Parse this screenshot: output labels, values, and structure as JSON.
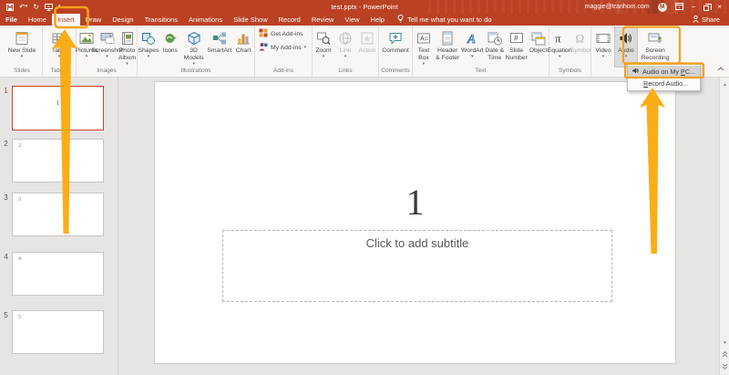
{
  "titlebar": {
    "title": "test.pptx - PowerPoint",
    "account_email": "maggie@tranhom.com",
    "avatar_initial": "M",
    "share_label": "Share"
  },
  "tabs": [
    "File",
    "Home",
    "Insert",
    "Draw",
    "Design",
    "Transitions",
    "Animations",
    "Slide Show",
    "Record",
    "Review",
    "View",
    "Help"
  ],
  "active_tab": "Insert",
  "tellme": {
    "label": "Tell me what you want to do"
  },
  "ribbon": {
    "groups": [
      {
        "name": "Slides",
        "buttons": [
          {
            "label": "New Slide"
          }
        ]
      },
      {
        "name": "Tables",
        "buttons": [
          {
            "label": "Table"
          }
        ]
      },
      {
        "name": "Images",
        "buttons": [
          {
            "label": "Pictures"
          },
          {
            "label": "Screenshot"
          },
          {
            "label": "Photo Album"
          }
        ]
      },
      {
        "name": "Illustrations",
        "buttons": [
          {
            "label": "Shapes"
          },
          {
            "label": "Icons"
          },
          {
            "label": "3D Models"
          },
          {
            "label": "SmartArt"
          },
          {
            "label": "Chart"
          }
        ]
      },
      {
        "name": "Add-ins",
        "buttons": [
          {
            "label": "Get Add-ins"
          },
          {
            "label": "My Add-ins"
          }
        ]
      },
      {
        "name": "Links",
        "buttons": [
          {
            "label": "Zoom"
          },
          {
            "label": "Link"
          },
          {
            "label": "Action"
          }
        ]
      },
      {
        "name": "Comments",
        "buttons": [
          {
            "label": "Comment"
          }
        ]
      },
      {
        "name": "Text",
        "buttons": [
          {
            "label": "Text Box"
          },
          {
            "label": "Header & Footer"
          },
          {
            "label": "WordArt"
          },
          {
            "label": "Date & Time"
          },
          {
            "label": "Slide Number"
          },
          {
            "label": "Object"
          }
        ]
      },
      {
        "name": "Symbols",
        "buttons": [
          {
            "label": "Equation"
          },
          {
            "label": "Symbol"
          }
        ]
      },
      {
        "name": "",
        "buttons": [
          {
            "label": "Video"
          },
          {
            "label": "Audio"
          },
          {
            "label": "Screen Recording"
          }
        ]
      }
    ]
  },
  "dropdown": {
    "items": [
      {
        "pre": "Audio on My ",
        "key": "P",
        "post": "C..."
      },
      {
        "pre": "",
        "key": "R",
        "post": "ecord Audio..."
      }
    ]
  },
  "panel": {
    "slides": [
      {
        "num": "1"
      },
      {
        "num": "2"
      },
      {
        "num": "3"
      },
      {
        "num": "4"
      },
      {
        "num": "5"
      }
    ]
  },
  "canvas": {
    "title": "1",
    "subtitle_placeholder": "Click to add subtitle"
  },
  "annotations": {
    "box_color": "#F6A11B",
    "arrow_color": "#FBAD17"
  }
}
